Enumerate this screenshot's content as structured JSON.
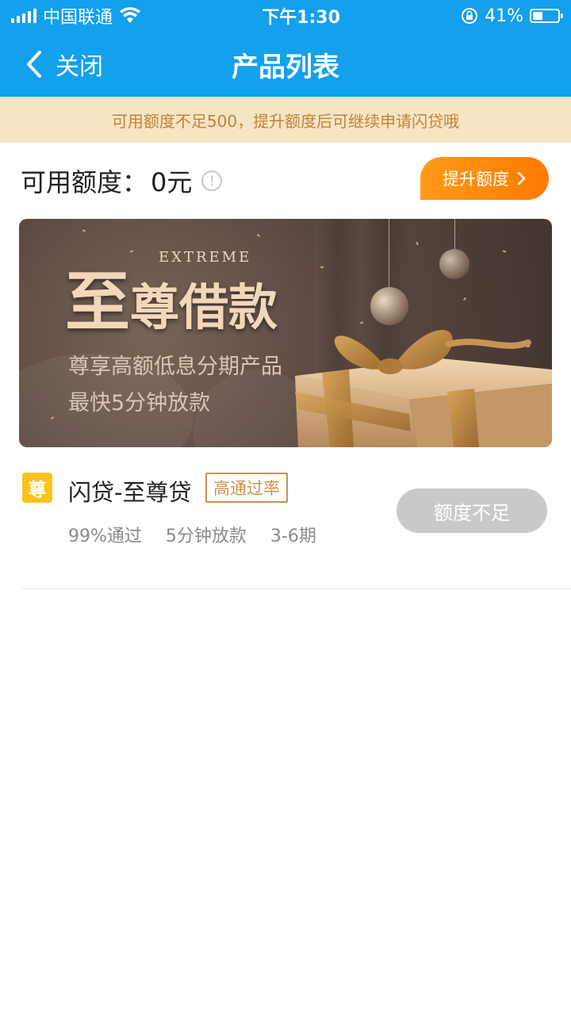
{
  "status_bar": {
    "carrier": "中国联通",
    "time": "下午1:30",
    "battery": "41%"
  },
  "nav": {
    "close_label": "关闭",
    "title": "产品列表"
  },
  "notice": {
    "text": "可用额度不足500，提升额度后可继续申请闪贷哦"
  },
  "quota": {
    "label": "可用额度：",
    "value": "0元",
    "raise_button": "提升额度"
  },
  "banner": {
    "title_big": "至",
    "title_rest": "尊借款",
    "title_en": "EXTREME",
    "subtitle_1": "尊享高额低息分期产品",
    "subtitle_2": "最快5分钟放款"
  },
  "product": {
    "badge": "尊",
    "name": "闪贷-至尊贷",
    "tag": "高通过率",
    "meta": [
      "99%通过",
      "5分钟放款",
      "3-6期"
    ],
    "button": "额度不足"
  },
  "colors": {
    "primary": "#13a0ec",
    "notice_bg": "#f6e5c2",
    "notice_text": "#c1833a",
    "accent_orange": "#ff8a00",
    "badge_yellow": "#ffc21a",
    "tag_gold": "#c9924a",
    "disabled_gray": "#c9c9c9"
  }
}
